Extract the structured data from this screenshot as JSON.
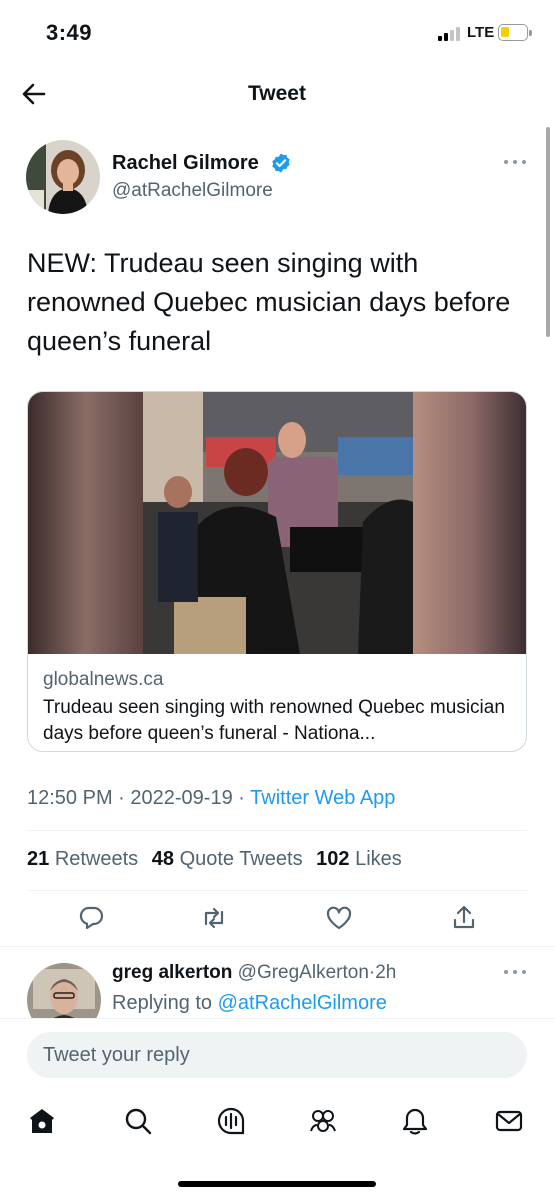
{
  "status_bar": {
    "time": "3:49",
    "network": "LTE",
    "battery_color": "#f7ce00"
  },
  "header": {
    "title": "Tweet",
    "back_icon": "arrow-left-icon"
  },
  "tweet": {
    "author_name": "Rachel Gilmore",
    "author_handle": "@atRachelGilmore",
    "verified": true,
    "text": "NEW: Trudeau seen singing with renowned Quebec musician days before queen’s funeral",
    "card": {
      "domain": "globalnews.ca",
      "title": "Trudeau seen singing with renowned Quebec musician days before queen’s funeral - Nationa..."
    },
    "time": "12:50 PM",
    "date": "2022-09-19",
    "source": "Twitter Web App",
    "separator": "·",
    "stats": {
      "retweets_count": "21",
      "retweets_label": "Retweets",
      "quotes_count": "48",
      "quotes_label": "Quote Tweets",
      "likes_count": "102",
      "likes_label": "Likes"
    },
    "actions": [
      "reply-icon",
      "retweet-icon",
      "like-icon",
      "share-icon"
    ]
  },
  "reply": {
    "author_name": "greg alkerton",
    "author_handle": "@GregAlkerton",
    "time_ago": "2h",
    "replying_label": "Replying to",
    "replying_to": "@atRachelGilmore"
  },
  "compose": {
    "placeholder": "Tweet your reply"
  },
  "tabs": [
    "home-icon",
    "search-icon",
    "spaces-icon",
    "communities-icon",
    "notifications-icon",
    "messages-icon"
  ],
  "colors": {
    "accent": "#1d9bf0",
    "secondary_text": "#536471",
    "primary_text": "#0f1419",
    "divider": "#eff3f4"
  }
}
